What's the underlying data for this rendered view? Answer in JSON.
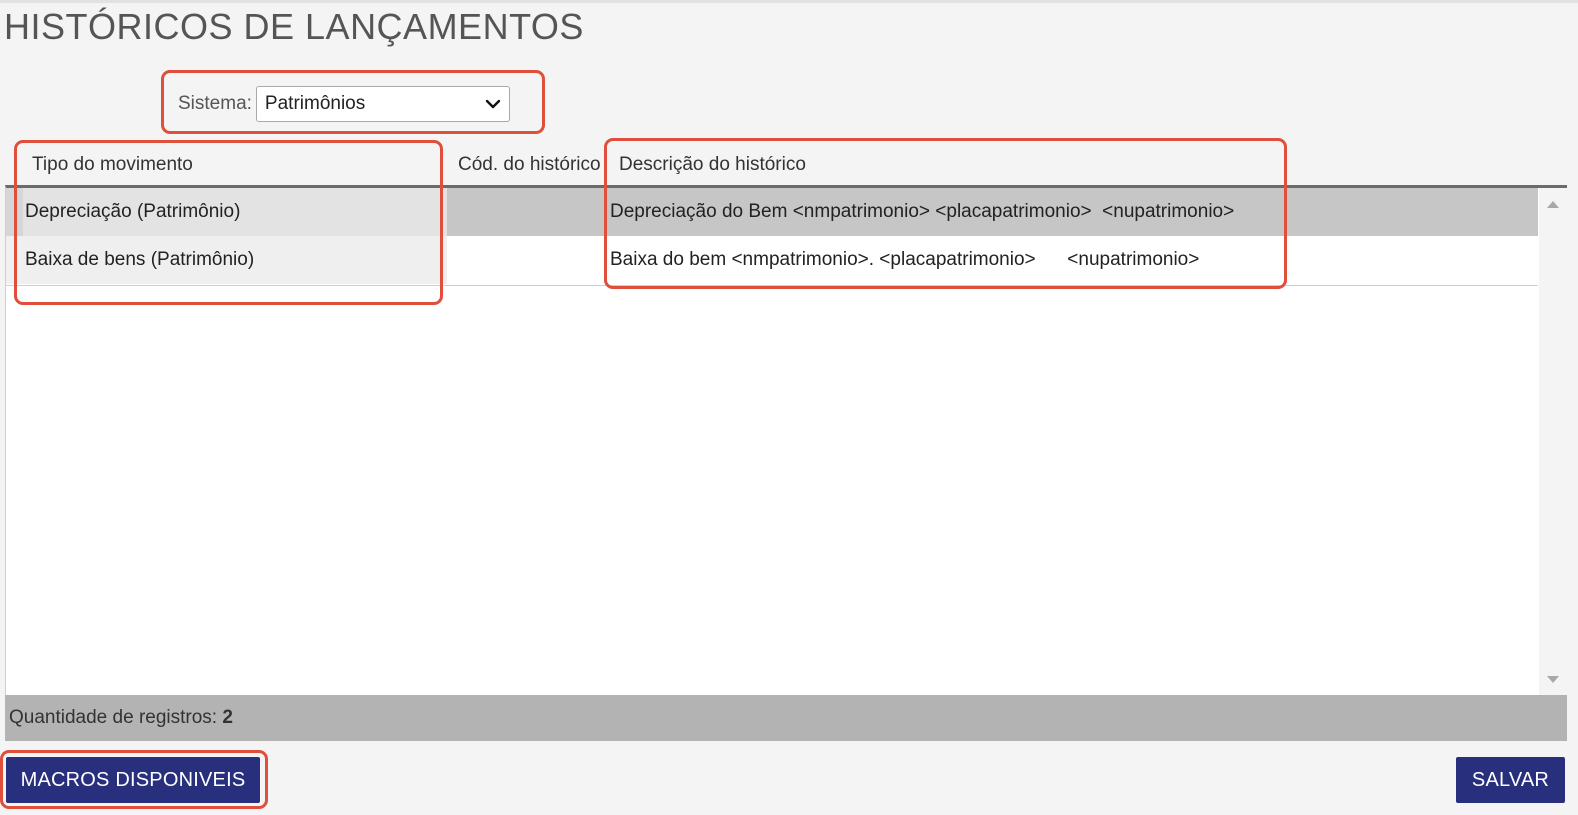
{
  "page": {
    "title": "HISTÓRICOS DE LANÇAMENTOS"
  },
  "filter": {
    "label": "Sistema:",
    "selected": "Patrimônios"
  },
  "table": {
    "columns": [
      "Tipo do movimento",
      "Cód. do histórico",
      "Descrição do histórico"
    ],
    "rows": [
      {
        "tipo": "Depreciação (Patrimônio)",
        "codigo": "",
        "descricao": "Depreciação do Bem <nmpatrimonio> <placapatrimonio>  <nupatrimonio>"
      },
      {
        "tipo": "Baixa de bens (Patrimônio)",
        "codigo": "",
        "descricao": "Baixa do bem <nmpatrimonio>. <placapatrimonio>      <nupatrimonio>"
      }
    ]
  },
  "footer": {
    "count_label": "Quantidade de registros:",
    "count_value": "2"
  },
  "actions": {
    "macros_label": "MACROS DISPONIVEIS",
    "save_label": "SALVAR"
  },
  "colors": {
    "button_bg": "#28307e",
    "highlight": "#e04e3c",
    "selected_row": "#c6c6c6"
  },
  "icons": {
    "select_arrow": "chevron-down-icon",
    "scroll_up": "scroll-up-arrow-icon",
    "scroll_down": "scroll-down-arrow-icon"
  }
}
